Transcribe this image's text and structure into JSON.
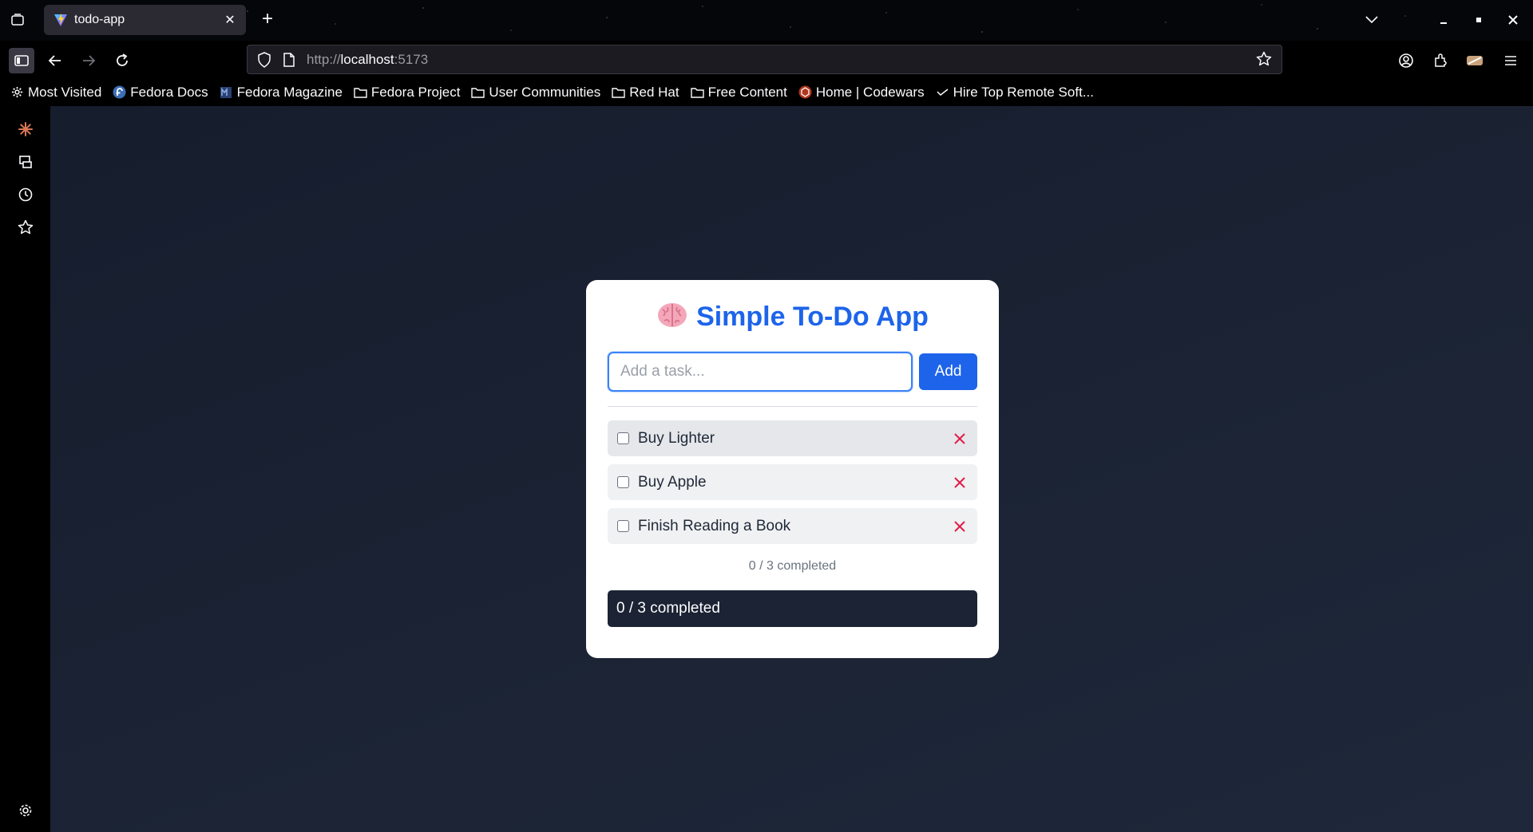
{
  "browser": {
    "tab": {
      "title": "todo-app"
    },
    "url": {
      "scheme": "http://",
      "host": "localhost",
      "port": ":5173"
    },
    "bookmarks": [
      {
        "label": "Most Visited",
        "icon": "gear-icon"
      },
      {
        "label": "Fedora Docs",
        "icon": "fedora-icon"
      },
      {
        "label": "Fedora Magazine",
        "icon": "fedora-magazine-icon"
      },
      {
        "label": "Fedora Project",
        "icon": "folder-icon"
      },
      {
        "label": "User Communities",
        "icon": "folder-icon"
      },
      {
        "label": "Red Hat",
        "icon": "folder-icon"
      },
      {
        "label": "Free Content",
        "icon": "folder-icon"
      },
      {
        "label": "Home | Codewars",
        "icon": "codewars-icon"
      },
      {
        "label": "Hire Top Remote Soft...",
        "icon": "arrow-icon"
      }
    ]
  },
  "app": {
    "title": "Simple To-Do App",
    "title_icon": "brain-icon",
    "input_placeholder": "Add a task...",
    "input_value": "",
    "add_label": "Add",
    "tasks": [
      {
        "text": "Buy Lighter",
        "done": false
      },
      {
        "text": "Buy Apple",
        "done": false
      },
      {
        "text": "Finish Reading a Book",
        "done": false
      }
    ],
    "summary": "0 / 3 completed",
    "status": "0 / 3 completed"
  },
  "colors": {
    "accent": "#1d64ea",
    "delete": "#e11d48",
    "status_bar": "#1b2334"
  }
}
